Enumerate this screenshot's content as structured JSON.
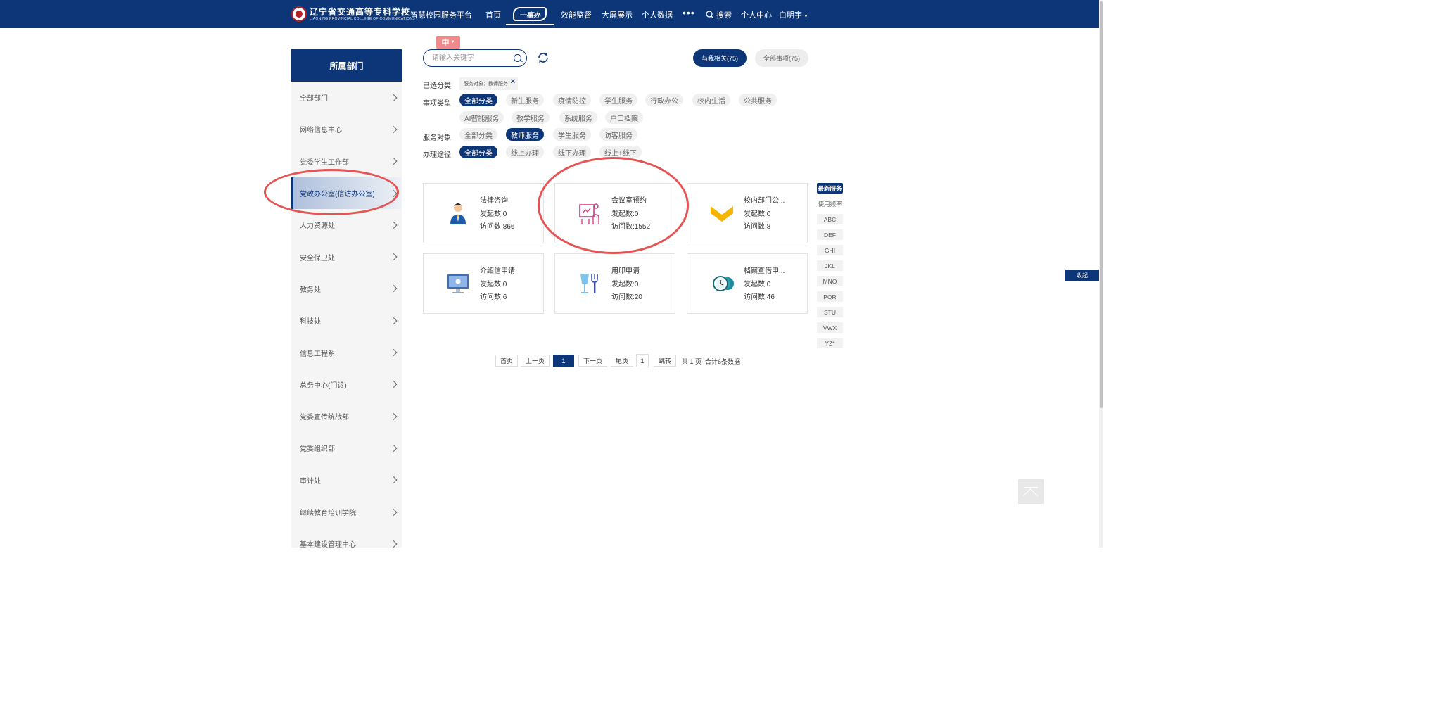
{
  "header": {
    "logo_cn": "辽宁省交通高等专科学校",
    "logo_en": "LIAONING PROVINCIAL COLLEGE OF COMMUNICATIONS",
    "platform": "智慧校园服务平台",
    "nav": {
      "home": "首页",
      "yishiban": "一事办",
      "efficiency": "效能监督",
      "bigscreen": "大屏展示",
      "personal_data": "个人数据",
      "more": "•••",
      "search": "搜索",
      "personal_center": "个人中心",
      "user": "白明宇"
    }
  },
  "sidebar": {
    "title": "所属部门",
    "items": [
      {
        "label": "全部部门"
      },
      {
        "label": "网络信息中心"
      },
      {
        "label": "党委学生工作部"
      },
      {
        "label": "党政办公室(信访办公室)",
        "active": true
      },
      {
        "label": "人力资源处"
      },
      {
        "label": "安全保卫处"
      },
      {
        "label": "教务处"
      },
      {
        "label": "科技处"
      },
      {
        "label": "信息工程系"
      },
      {
        "label": "总务中心(门诊)"
      },
      {
        "label": "党委宣传统战部"
      },
      {
        "label": "党委组织部"
      },
      {
        "label": "审计处"
      },
      {
        "label": "继续教育培训学院"
      },
      {
        "label": "基本建设管理中心"
      }
    ]
  },
  "toolbar": {
    "lang": "中",
    "search_placeholder": "请输入关键字",
    "mine_label": "与我相关(75)",
    "all_label": "全部事项(75)"
  },
  "filters": {
    "selected_label": "已选分类",
    "selected_chip": "服务对象：教师服务",
    "type_label": "事项类型",
    "types": [
      "全部分类",
      "新生服务",
      "疫情防控",
      "学生服务",
      "行政办公",
      "校内生活",
      "公共服务",
      "AI智能服务",
      "教学服务",
      "系统服务",
      "户口档案"
    ],
    "audience_label": "服务对象",
    "audiences": [
      "全部分类",
      "教师服务",
      "学生服务",
      "访客服务"
    ],
    "channel_label": "办理途径",
    "channels": [
      "全部分类",
      "线上办理",
      "线下办理",
      "线上+线下"
    ]
  },
  "cards": [
    {
      "title": "法律咨询",
      "initiated": "发起数:0",
      "visits": "访问数:866",
      "icon": "lawyer-icon"
    },
    {
      "title": "会议室预约",
      "initiated": "发起数:0",
      "visits": "访问数:1552",
      "icon": "meeting-icon"
    },
    {
      "title": "校内部门公...",
      "initiated": "发起数:0",
      "visits": "访问数:8",
      "icon": "chevron-badge-icon"
    },
    {
      "title": "介绍信申请",
      "initiated": "发起数:0",
      "visits": "访问数:6",
      "icon": "computer-icon"
    },
    {
      "title": "用印申请",
      "initiated": "发起数:0",
      "visits": "访问数:20",
      "icon": "cup-fork-icon"
    },
    {
      "title": "档案查借申...",
      "initiated": "发起数:0",
      "visits": "访问数:46",
      "icon": "clock-archive-icon"
    }
  ],
  "index": {
    "latest": "最新服务",
    "frequency": "使用频率",
    "letters": [
      "ABC",
      "DEF",
      "GHI",
      "JKL",
      "MNO",
      "PQR",
      "STU",
      "VWX",
      "YZ*"
    ]
  },
  "collapse_label": "收起",
  "pagination": {
    "first": "首页",
    "prev": "上一页",
    "current": "1",
    "next": "下一页",
    "last": "尾页",
    "jump_value": "1",
    "jump": "跳转",
    "total_pages": "共 1 页",
    "total_items": "合计6条数据"
  },
  "colors": {
    "primary": "#0d3678",
    "annotation": "#e55454",
    "lang_tag": "#f18a8a"
  }
}
